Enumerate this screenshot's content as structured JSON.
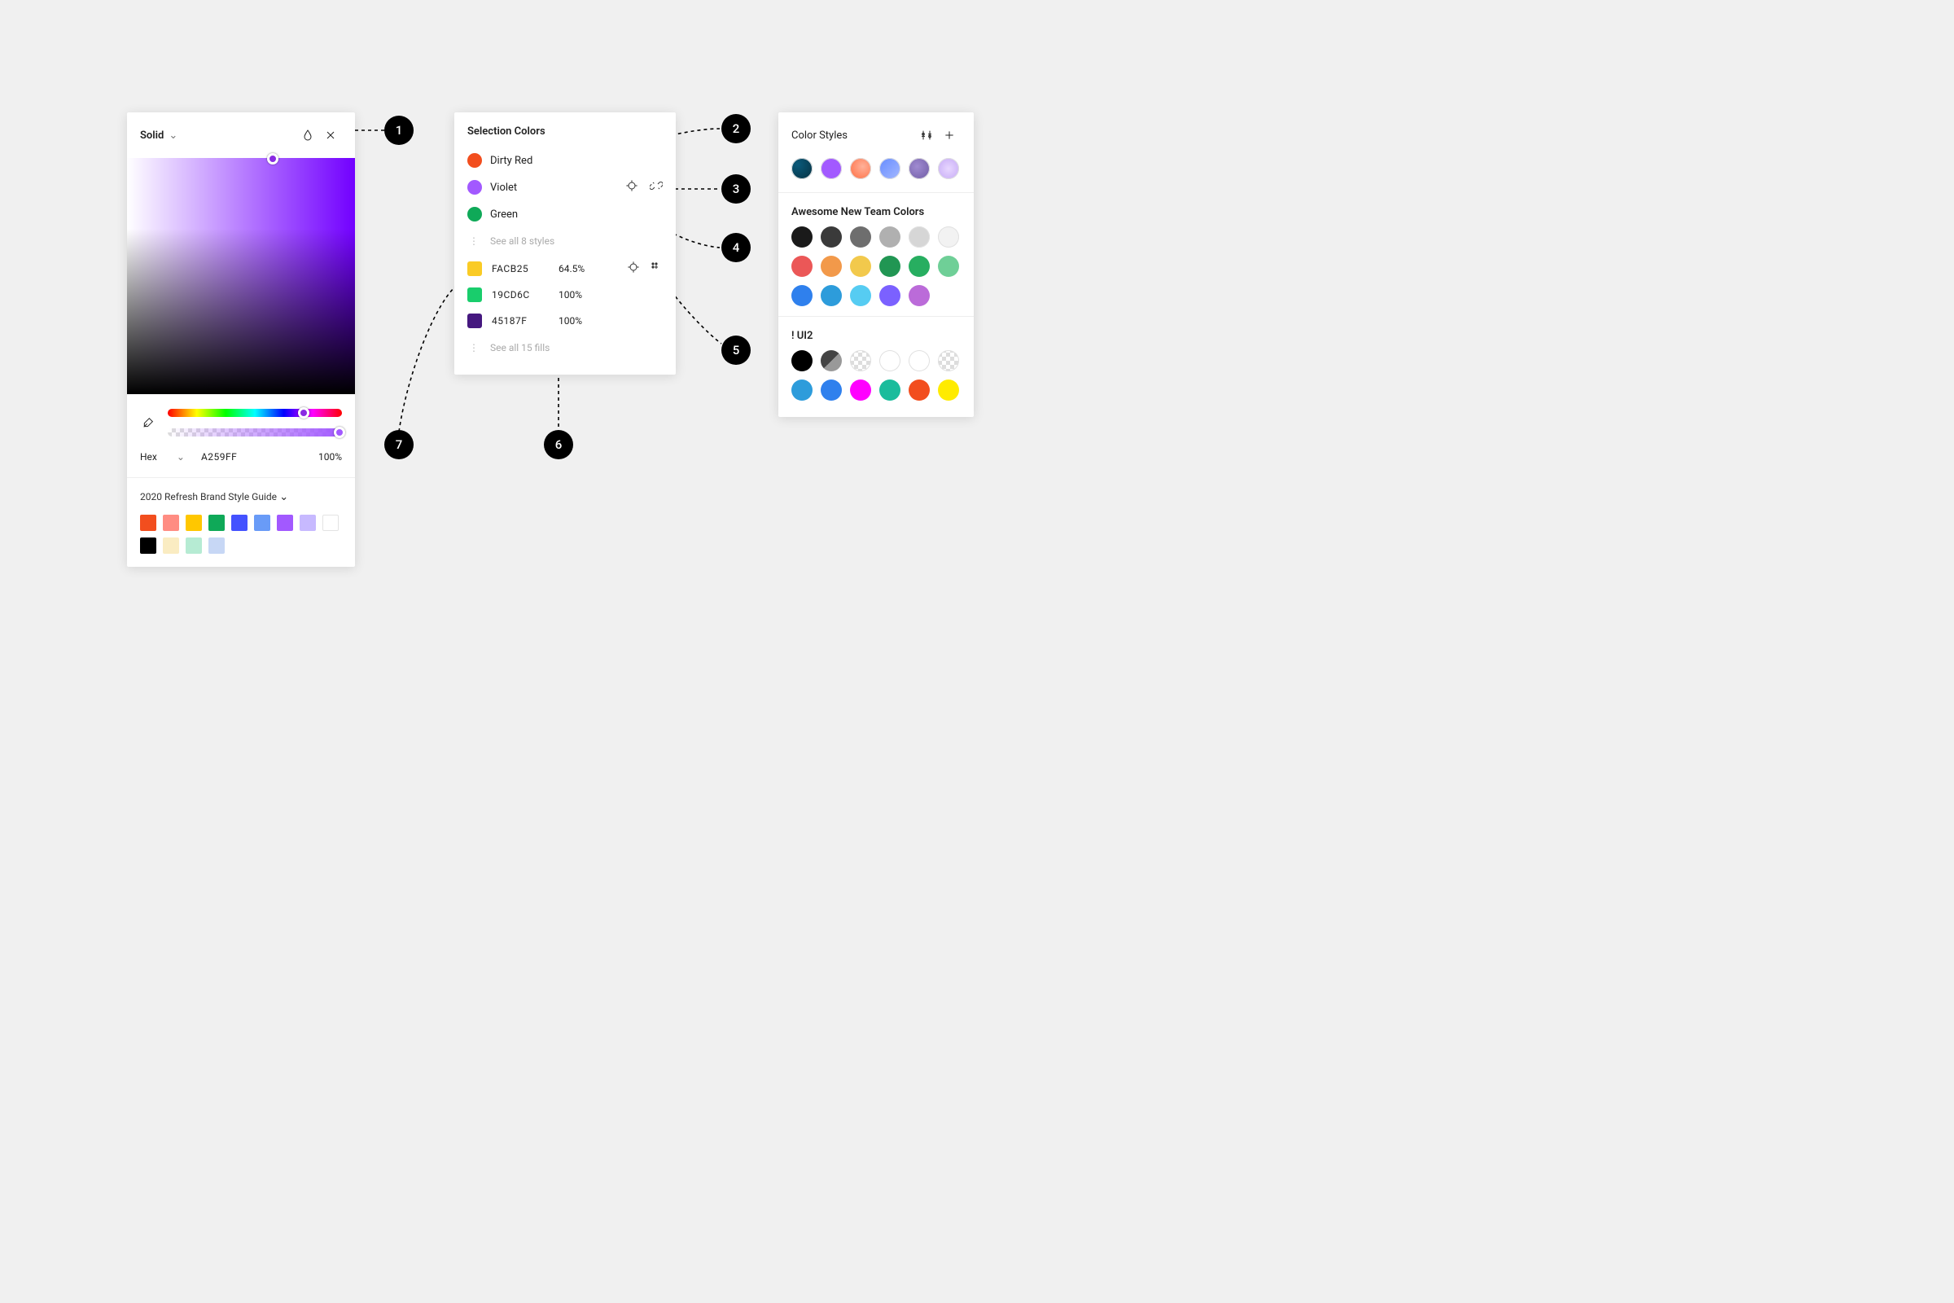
{
  "picker": {
    "mode": "Solid",
    "hexLabel": "Hex",
    "hexValue": "A259FF",
    "opacity": "100%",
    "library": {
      "title": "2020 Refresh Brand Style Guide",
      "swatches": [
        "#F24E1E",
        "#FF8C82",
        "#FFC700",
        "#0FA958",
        "#4452FF",
        "#699BF7",
        "#A259FF",
        "#C7B9FF",
        "#FFFFFF",
        "#000000",
        "#FAECC2",
        "#B6EBD3",
        "#C7D7F5"
      ]
    }
  },
  "selection": {
    "title": "Selection Colors",
    "styles": [
      {
        "name": "Dirty Red",
        "color": "#F24E1E"
      },
      {
        "name": "Violet",
        "color": "#A259FF"
      },
      {
        "name": "Green",
        "color": "#0FA958"
      }
    ],
    "seeAllStyles": "See all 8 styles",
    "fills": [
      {
        "hex": "FACB25",
        "opacity": "64.5%",
        "color": "#FACB25"
      },
      {
        "hex": "19CD6C",
        "opacity": "100%",
        "color": "#19CD6C"
      },
      {
        "hex": "45187F",
        "opacity": "100%",
        "color": "#45187F"
      }
    ],
    "seeAllFills": "See all 15 fills"
  },
  "styles": {
    "title": "Color Styles",
    "top": [
      {
        "bg": "radial-gradient(circle at 30% 30%, #0a5a7a, #063040)"
      },
      {
        "bg": "#A259FF"
      },
      {
        "bg": "radial-gradient(circle at 60% 40%, #ffb199, #ff6a3d)",
        "selected": true
      },
      {
        "bg": "linear-gradient(135deg, #668cff, #a4b8ff)"
      },
      {
        "bg": "radial-gradient(circle at 40% 40%, #a08bd1, #6e5aa3)"
      },
      {
        "bg": "radial-gradient(circle at 50% 50%, #e8d7ff, #c4a8f5)"
      }
    ],
    "sections": [
      {
        "title": "Awesome New Team Colors",
        "colors": [
          "#1A1A1A",
          "#3A3A3A",
          "#6E6E6E",
          "#B0B0B0",
          "#D6D6D6",
          "#F2F2F2",
          "#EB5757",
          "#F2994A",
          "#F2C94C",
          "#219653",
          "#27AE60",
          "#6FCF97",
          "#2F80ED",
          "#2D9CDB",
          "#56CCF2",
          "#7B61FF",
          "#BB6BD9"
        ]
      },
      {
        "title": "! UI2",
        "colors": [
          "#000000",
          "diag",
          "checker",
          "outline",
          "outline",
          "checker",
          "#2D9CDB",
          "#2F80ED",
          "#FF00FF",
          "#1ABC9C",
          "#F24E1E",
          "#FFEB00"
        ]
      }
    ]
  },
  "badges": [
    "1",
    "2",
    "3",
    "4",
    "5",
    "6",
    "7"
  ]
}
